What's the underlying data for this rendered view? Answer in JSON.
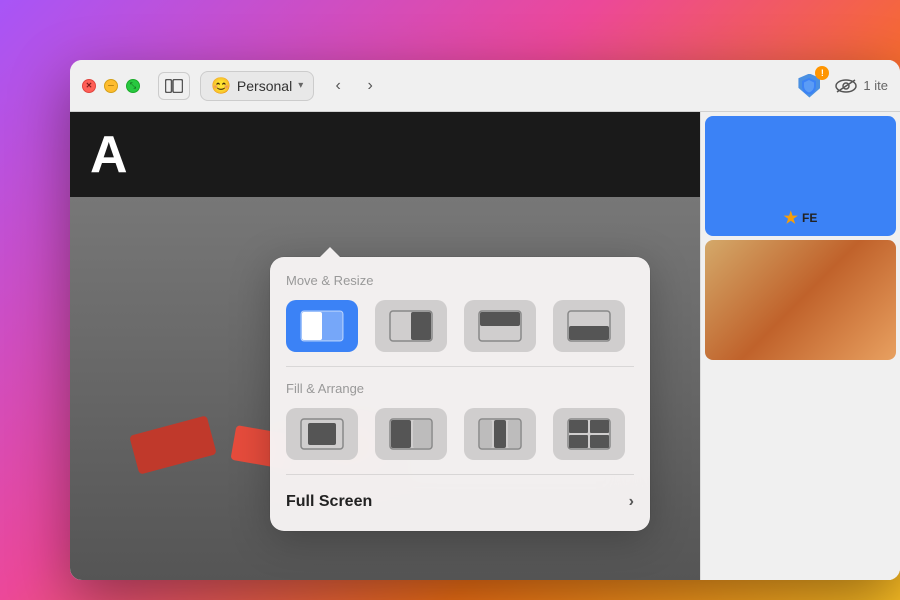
{
  "desktop": {
    "bg_gradient": "linear-gradient(135deg, #a855f7 0%, #ec4899 40%, #f97316 70%, #fbbf24 100%)"
  },
  "titlebar": {
    "space_emoji": "😊",
    "space_name": "Personal",
    "nav_back": "‹",
    "nav_forward": "›",
    "view_label": "1 ite",
    "sidebar_tooltip": "Toggle Sidebar"
  },
  "popup": {
    "move_resize_label": "Move & Resize",
    "fill_arrange_label": "Fill & Arrange",
    "full_screen_label": "Full Screen",
    "chevron": "›",
    "layouts": [
      {
        "id": "left-half",
        "active": true
      },
      {
        "id": "right-half",
        "active": false
      },
      {
        "id": "top-half",
        "active": false
      },
      {
        "id": "bottom-half",
        "active": false
      },
      {
        "id": "center",
        "active": false
      },
      {
        "id": "left-third",
        "active": false
      },
      {
        "id": "right-third",
        "active": false
      },
      {
        "id": "four-grid",
        "active": false
      }
    ]
  },
  "content": {
    "header_letter": "A",
    "right_badge": "FE",
    "star": "★"
  }
}
